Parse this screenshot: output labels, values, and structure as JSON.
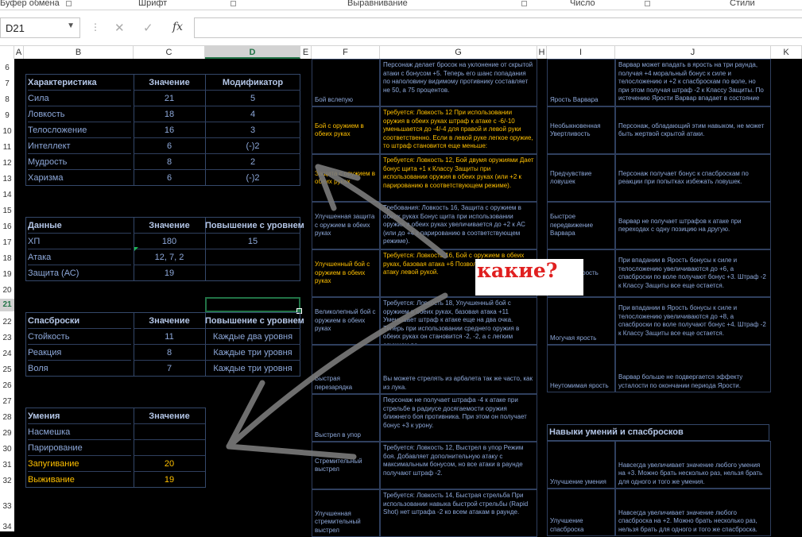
{
  "ribbon": {
    "groups": [
      "Буфер обмена",
      "Шрифт",
      "Выравнивание",
      "Число",
      "Стили"
    ]
  },
  "formula_bar": {
    "name_box": "D21",
    "fx_label": "fx",
    "formula": ""
  },
  "columns": [
    "A",
    "B",
    "C",
    "D",
    "E",
    "F",
    "G",
    "H",
    "I",
    "J",
    "K"
  ],
  "selected_column": "D",
  "rows": [
    "6",
    "7",
    "8",
    "9",
    "10",
    "11",
    "12",
    "13",
    "14",
    "15",
    "16",
    "17",
    "18",
    "19",
    "20",
    "21",
    "22",
    "23",
    "24",
    "25",
    "26",
    "27",
    "28",
    "29",
    "30",
    "31",
    "32",
    "33",
    "34"
  ],
  "selected_row": "21",
  "characteristics": {
    "headers": [
      "Характеристика",
      "Значение",
      "Модификатор"
    ],
    "rows": [
      [
        "Сила",
        "21",
        "5"
      ],
      [
        "Ловкость",
        "18",
        "4"
      ],
      [
        "Телосложение",
        "16",
        "3"
      ],
      [
        "Интеллект",
        "6",
        "(-)2"
      ],
      [
        "Мудрость",
        "8",
        "2"
      ],
      [
        "Харизма",
        "6",
        "(-)2"
      ]
    ]
  },
  "data_table": {
    "headers": [
      "Данные",
      "Значение",
      "Повышение с уровнем"
    ],
    "rows": [
      [
        "ХП",
        "180",
        "15"
      ],
      [
        "Атака",
        "12, 7, 2",
        ""
      ],
      [
        "Защита (АС)",
        "19",
        ""
      ]
    ]
  },
  "saves": {
    "headers": [
      "Спасброски",
      "Значение",
      "Повышение с уровнем"
    ],
    "rows": [
      [
        "Стойкость",
        "11",
        "Каждые два уровня"
      ],
      [
        "Реакция",
        "8",
        "Каждые три уровня"
      ],
      [
        "Воля",
        "7",
        "Каждые три уровня"
      ]
    ]
  },
  "skills": {
    "headers": [
      "Умения",
      "Значение"
    ],
    "rows": [
      [
        "Насмешка",
        ""
      ],
      [
        "Парирование",
        ""
      ],
      [
        "Запугивание",
        "20"
      ],
      [
        "Выживание",
        "19"
      ]
    ]
  },
  "feats": [
    {
      "name": "Бой вслепую",
      "desc": "Персонаж делает бросок на уклонение от скрытой атаки с бонусом +5. Теперь его шанс попадания по наполовину видимому противнику составляет не 50, а 75 процентов.",
      "highlight": false
    },
    {
      "name": "Бой с оружием в обеих руках",
      "desc": "Требуется: Ловкость 12 При использовании оружия в обеих руках штраф к атаке с -6/-10 уменьшается до -4/-4 для правой и левой руки соответственно. Если в левой руке легкое оружие, то штраф становится еще меньше:",
      "highlight": true
    },
    {
      "name": "Защита с оружием в обеих руках",
      "desc": "Требуется: Ловкость 12, Бой двумя оружиями Дает бонус щита +1 к Классу Защиты при использовании оружия в обеих руках (или +2 к парированию в соответствующем режиме).",
      "highlight": true
    },
    {
      "name": "Улучшенная защита с оружием в обеих руках",
      "desc": "Требования: Ловкость 16, Защита с оружием в обеих руках Бонус щита при использовании оружия в обеих руках увеличивается до +2 к АС (или до +4 к парированию в соответствующем режиме).",
      "highlight": false
    },
    {
      "name": "Улучшенный бой с оружием в обеих руках",
      "desc": "Требуется: Ловкость 16, Бой с оружием в обеих руках, базовая атака +6 Позволяет делать вторую атаку левой рукой.",
      "highlight": true
    },
    {
      "name": "Великолепный бой с оружием в обеих руках",
      "desc": "Требуется: Ловкость 18, Улучшенный бой с оружием в обеих руках, базовая атака +11 Уменьшает штраф к атаке еще на два очка. Теперь при использовании среднего оружия в обеих руках он становится -2, -2, а с легким оружием во",
      "highlight": false
    },
    {
      "name": "Быстрая перезарядка",
      "desc": "Вы можете стрелять из арбалета так же часто, как из лука.",
      "highlight": false
    },
    {
      "name": "Выстрел в упор",
      "desc": "Персонаж не получает штрафа -4 к атаке при стрельбе в радиусе досягаемости оружия ближнего боя противника. При этом он получает бонус +3 к урону.",
      "highlight": false
    },
    {
      "name": "Стремительный выстрел",
      "desc": "Требуется: Ловкость 12, Выстрел в упор Режим боя. Добавляет дополнительную атаку с максимальным бонусом, но все атаки в раунде получают штраф -2.",
      "highlight": false
    },
    {
      "name": "Улучшенная стремительный выстрел",
      "desc": "Требуется: Ловкость 14, Быстрая стрельба При использовании навыка быстрой стрельбы (Rapid Shot) нет штрафа -2 ко всем атакам в раунде.",
      "highlight": false
    }
  ],
  "barbarian": [
    {
      "name": "Ярость Варвара",
      "desc": "Варвар может впадать в ярость на три раунда, получая +4 моральный бонус к силе и телосложению и +2 к спасброскам по воле, но при этом получая штраф -2 к Классу Защиты. По истечению Ярости Варвар впадает в состояние"
    },
    {
      "name": "Необыкновенная Увертливость",
      "desc": "Персонаж, обладающий этим навыком, не может быть жертвой скрытой атаки."
    },
    {
      "name": "Предчувствие ловушек",
      "desc": "Персонаж получает бонус к спасброскам по реакции при попытках избежать ловушек."
    },
    {
      "name": "Быстрое передвижение Варвара",
      "desc": "Варвар не получает штрафов к атаке при переходах с одну позицию на другую."
    },
    {
      "name": "Большая ярость",
      "desc": "При впадании в Ярость бонусы к силе и телосложению увеличиваются до +6, а спасброски по воле получают бонус +3. Штраф -2 к Классу Защиты все еще остается."
    },
    {
      "name": "Могучая ярость",
      "desc": "При впадании в Ярость бонусы к силе и телосложению увеличиваются до +8, а спасброски по воле получают бонус +4. Штраф -2 к Классу Защиты все еще остается."
    },
    {
      "name": "Неутомимая ярость",
      "desc": "Варвар больше не подвергается эффекту усталости по окончании периода Ярости."
    }
  ],
  "skill_saves": {
    "header": "Навыки умений и спасбросков",
    "rows": [
      {
        "name": "Улучшение умения",
        "desc": "Навсегда увеличивает значение любого умения на +3. Можно брать несколько раз, нельзя брать для одного и того же умения."
      },
      {
        "name": "Улучшение спасброска",
        "desc": "Навсегда увеличивает значение любого спасброска на +2. Можно брать несколько раз, нельзя брать для одного и того же спасброска."
      }
    ]
  },
  "annotation": "какие?"
}
